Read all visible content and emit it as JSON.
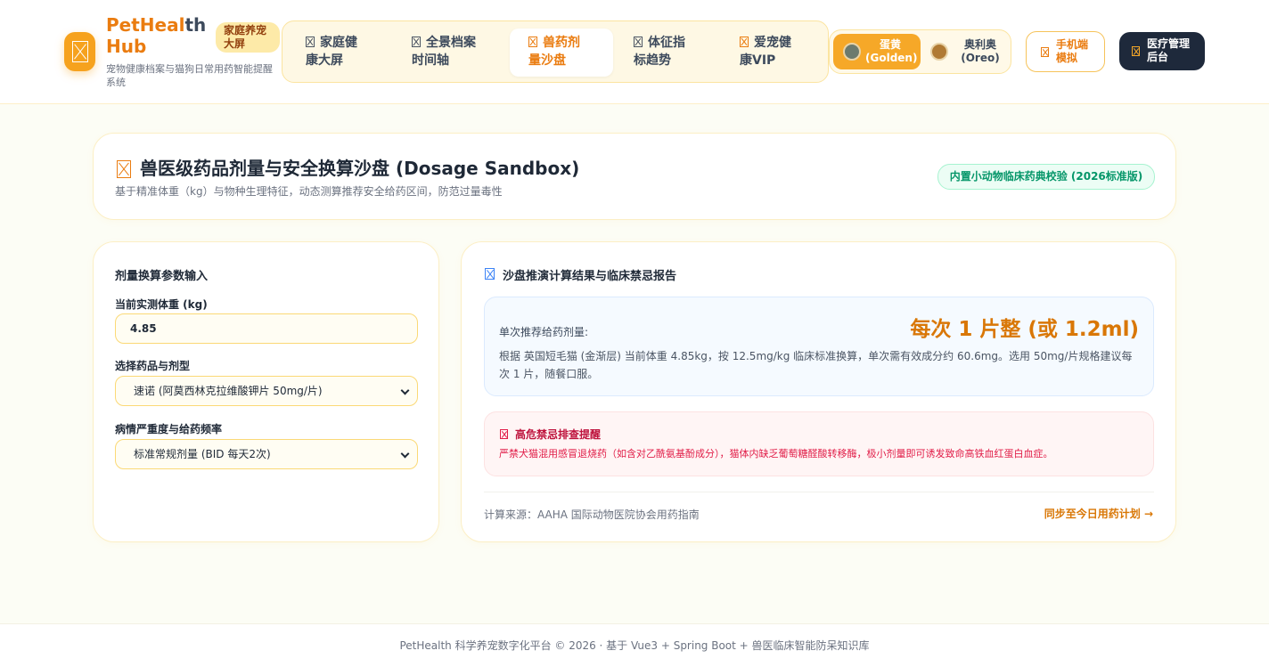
{
  "header": {
    "brand_part1": "PetHeal",
    "brand_part2": "th",
    "brand_line2": "Hub",
    "family_badge": "家庭养宠大屏",
    "tagline": "宠物健康档案与猫狗日常用药智能提醒系统",
    "nav": [
      {
        "label_l1": "家庭健",
        "label_l2": "康大屏",
        "icon": "dashboard-icon"
      },
      {
        "label_l1": "全景档案",
        "label_l2": "时间轴",
        "icon": "timeline-icon"
      },
      {
        "label_l1": "兽药剂",
        "label_l2": "量沙盘",
        "icon": "medicine-icon",
        "active": true
      },
      {
        "label_l1": "体征指",
        "label_l2": "标趋势",
        "icon": "chart-icon"
      },
      {
        "label_l1": "爱宠健",
        "label_l2": "康VIP",
        "icon": "vip-icon"
      }
    ],
    "pets": [
      {
        "name": "蛋黄",
        "breed": "(Golden)",
        "active": true
      },
      {
        "name": "奥利奥",
        "breed": "(Oreo)",
        "active": false
      }
    ],
    "mobile_btn_l1": "手机端",
    "mobile_btn_l2": "模拟",
    "admin_btn_l1": "医疗管理",
    "admin_btn_l2": "后台"
  },
  "title_card": {
    "title": "兽医级药品剂量与安全换算沙盘 (Dosage Sandbox)",
    "subtitle": "基于精准体重（kg）与物种生理特征，动态测算推荐安全给药区间，防范过量毒性",
    "badge": "内置小动物临床药典校验 (2026标准版)"
  },
  "inputs": {
    "section_title": "剂量换算参数输入",
    "weight_label": "当前实测体重 (kg)",
    "weight_value": "4.85",
    "drug_label": "选择药品与剂型",
    "drug_value": "速诺 (阿莫西林克拉维酸钾片 50mg/片)",
    "severity_label": "病情严重度与给药频率",
    "severity_value": "标准常规剂量 (BID 每天2次)"
  },
  "result": {
    "section_title": "沙盘推演计算结果与临床禁忌报告",
    "dose_label": "单次推荐给药剂量:",
    "dose_value": "每次 1 片整 (或 1.2ml)",
    "dose_desc": "根据 英国短毛猫 (金渐层) 当前体重 4.85kg，按 12.5mg/kg 临床标准换算，单次需有效成分约 60.6mg。选用 50mg/片规格建议每次 1 片，随餐口服。",
    "warn_title": "高危禁忌排查提醒",
    "warn_desc": "严禁犬猫混用感冒退烧药（如含对乙酰氨基酚成分），猫体内缺乏葡萄糖醛酸转移酶，极小剂量即可诱发致命高铁血红蛋白血症。",
    "source": "计算来源：AAHA 国际动物医院协会用药指南",
    "sync_link": "同步至今日用药计划 →"
  },
  "footer": {
    "text": "PetHealth 科学养宠数字化平台 © 2026 · 基于 Vue3 + Spring Boot + 兽医临床智能防呆知识库"
  },
  "colors": {
    "accent": "#ea7c10",
    "dark": "#1e293b",
    "danger": "#e11d48"
  }
}
